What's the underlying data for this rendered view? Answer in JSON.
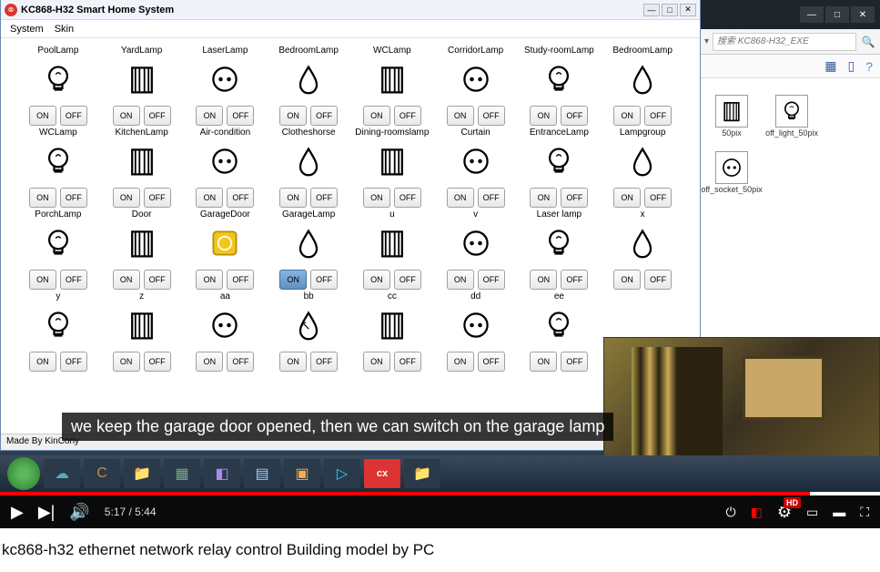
{
  "app": {
    "title": "KC868-H32 Smart Home System",
    "menu": [
      "System",
      "Skin"
    ],
    "footer": "Made By KinCony"
  },
  "buttons": {
    "on": "ON",
    "off": "OFF"
  },
  "devices": [
    {
      "label": "PoolLamp",
      "icon": "bulb"
    },
    {
      "label": "YardLamp",
      "icon": "door"
    },
    {
      "label": "LaserLamp",
      "icon": "socket"
    },
    {
      "label": "BedroomLamp",
      "icon": "drop"
    },
    {
      "label": "WCLamp",
      "icon": "door"
    },
    {
      "label": "CorridorLamp",
      "icon": "socket"
    },
    {
      "label": "Study-roomLamp",
      "icon": "bulb"
    },
    {
      "label": "BedroomLamp",
      "icon": "drop"
    },
    {
      "label": "WCLamp",
      "icon": "bulb"
    },
    {
      "label": "KitchenLamp",
      "icon": "door"
    },
    {
      "label": "Air-condition",
      "icon": "socket"
    },
    {
      "label": "Clotheshorse",
      "icon": "drop"
    },
    {
      "label": "Dining-roomslamp",
      "icon": "door"
    },
    {
      "label": "Curtain",
      "icon": "socket"
    },
    {
      "label": "EntranceLamp",
      "icon": "bulb"
    },
    {
      "label": "Lampgroup",
      "icon": "drop"
    },
    {
      "label": "PorchLamp",
      "icon": "bulb"
    },
    {
      "label": "Door",
      "icon": "door"
    },
    {
      "label": "GarageDoor",
      "icon": "warn"
    },
    {
      "label": "GarageLamp",
      "icon": "drop",
      "on_active": true
    },
    {
      "label": "u",
      "icon": "door"
    },
    {
      "label": "v",
      "icon": "socket"
    },
    {
      "label": "Laser lamp",
      "icon": "bulb"
    },
    {
      "label": "x",
      "icon": "drop"
    },
    {
      "label": "y",
      "icon": "bulb"
    },
    {
      "label": "z",
      "icon": "door"
    },
    {
      "label": "aa",
      "icon": "socket"
    },
    {
      "label": "bb",
      "icon": "drop"
    },
    {
      "label": "cc",
      "icon": "door"
    },
    {
      "label": "dd",
      "icon": "socket"
    },
    {
      "label": "ee",
      "icon": "bulb"
    }
  ],
  "explorer": {
    "search_placeholder": "搜索 KC868-H32_EXE",
    "files": [
      {
        "label": "50pix",
        "icon": "door"
      },
      {
        "label": "off_light_50pix",
        "icon": "bulb"
      },
      {
        "label": "off_socket_50pix",
        "icon": "socket"
      }
    ]
  },
  "caption": "we keep the garage door opened, then we can switch on the garage lamp",
  "youtube": {
    "current": "5:17",
    "total": "5:44",
    "progress_pct": 92,
    "quality": "HD"
  },
  "video_title": "kc868-h32 ethernet network relay control Building model by PC"
}
